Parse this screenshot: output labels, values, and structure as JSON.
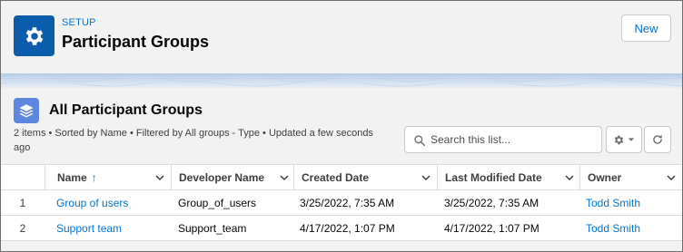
{
  "header": {
    "section_label": "SETUP",
    "title": "Participant Groups",
    "new_button_label": "New"
  },
  "list": {
    "title": "All Participant Groups",
    "meta": "2 items • Sorted by Name • Filtered by All groups - Type • Updated a few seconds ago",
    "search_placeholder": "Search this list...",
    "columns": [
      "Name",
      "Developer Name",
      "Created Date",
      "Last Modified Date",
      "Owner"
    ],
    "sort_indicator": "↑",
    "rows": [
      {
        "num": "1",
        "name": "Group of users",
        "developer_name": "Group_of_users",
        "created": "3/25/2022, 7:35 AM",
        "modified": "3/25/2022, 7:35 AM",
        "owner": "Todd Smith"
      },
      {
        "num": "2",
        "name": "Support team",
        "developer_name": "Support_team",
        "created": "4/17/2022, 1:07 PM",
        "modified": "4/17/2022, 1:07 PM",
        "owner": "Todd Smith"
      }
    ]
  },
  "icons": {
    "setup": "gear-icon",
    "list": "stack-icon",
    "search": "search-icon",
    "settings": "gear-icon",
    "refresh": "refresh-icon",
    "column_menu": "chevron-down-icon"
  },
  "colors": {
    "brand_icon": "#0b5cab",
    "list_icon": "#5d87de",
    "link": "#0176d3"
  }
}
